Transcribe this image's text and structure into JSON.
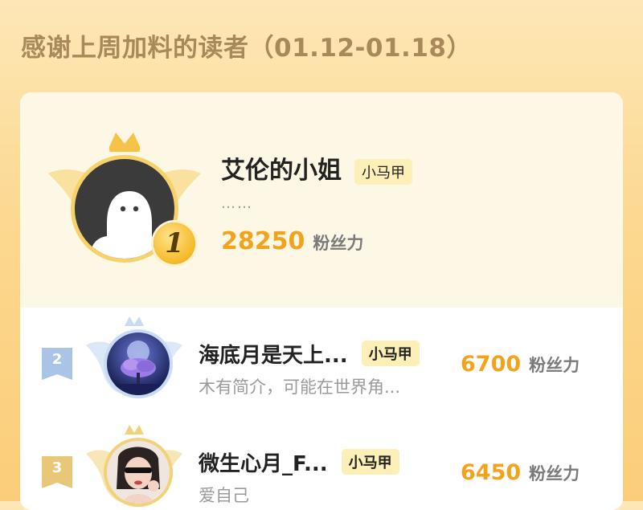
{
  "header": {
    "title": "感谢上周加料的读者（01.12-01.18）"
  },
  "colors": {
    "accent": "#f3a31b",
    "tag_bg": "#fcefb7",
    "background": "#fcd890"
  },
  "leaderboard": {
    "top": {
      "rank": "1",
      "name": "艾伦的小姐",
      "tag": "小马甲",
      "bio": "……",
      "score": "28250",
      "unit": "粉丝力",
      "icons": [
        "crown-icon",
        "wings-icon",
        "ghost-avatar-icon"
      ]
    },
    "rows": [
      {
        "rank": "2",
        "name": "海底月是天上...",
        "tag": "小马甲",
        "bio": "木有简介，可能在世界角...",
        "score": "6700",
        "unit": "粉丝力"
      },
      {
        "rank": "3",
        "name": "微生心月_F...",
        "tag": "小马甲",
        "bio": "爱自己",
        "score": "6450",
        "unit": "粉丝力"
      }
    ]
  }
}
